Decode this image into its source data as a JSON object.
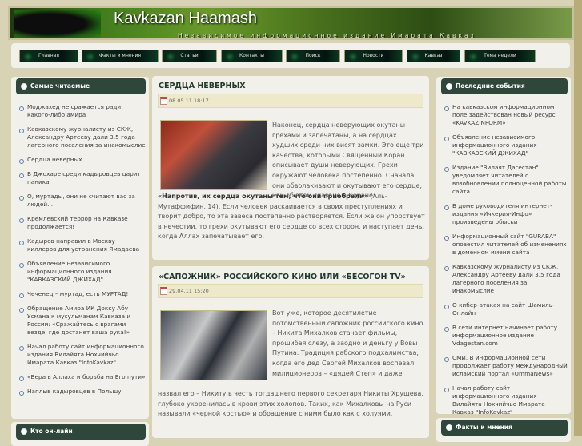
{
  "header": {
    "title": "Kavkazan Haamash",
    "subtitle": "Независимое информационное издание Имарата Кавказ"
  },
  "nav": [
    "Главная",
    "Факты и мнения",
    "Статьи",
    "Контакты",
    "Поиск",
    "Новости",
    "Кавказ",
    "Тема недели"
  ],
  "left": {
    "heading": "Самые читаемые",
    "items": [
      "Моджахед не сражается ради какого-либо амира",
      "Кавказскому журналисту из СКЖ, Александру Артееву дали 3.5 года лагерного поселения за инакомыслие",
      "Сердца неверных",
      "В Джохаре среди кадыровцев царит паника",
      "О, муртады, они не считают вас за людей...",
      "Кремлевский террор на Кавказе продолжается!",
      "Кадыров направил в Москву киллеров для устранения Ямадаева",
      "Объявление независимого информационного издания \"КАВКАЗСКИЙ ДЖИХАД\"",
      "Чеченец – муртад, есть МУРТАД!",
      "Обращение Амира ИК Доккy Абу Усмана к мусульманам Кавказа и России: «Сражайтесь с врагами везде, где достанет ваша рука!»",
      "Начал работу сайт информационного издания Вилайята Нохчийчьо Имарата Кавказ \"InfoKavkaz\"",
      "«Вера в Аллаха и борьба на Его пути»",
      "Наплыв кадыровцев в Польшу"
    ],
    "heading2": "Кто он-лайн"
  },
  "right": {
    "heading": "Последние события",
    "items": [
      "На кавказском информационном поле задействован новый ресурс «KAVKAZINFORM»",
      "Объявление независимого информационного издания \"КАВКАЗСКИЙ ДЖИХАД\"",
      "Издание \"Вилаят Дагестан\" уведомляет читателей о возобновлении полноценной работы сайта",
      "В доме руководителя интернет-издания «Ичкерия-Инфо» произведены обыски",
      "Информационный сайт \"GURABA\" оповестил читателей об изменениях в доменном имени сайта",
      "Кавказскому журналисту из СКЖ, Александру Артееву дали 3.5 года лагерного поселения за инакомыслие",
      "О кибер-атаках на сайт Шамиль-Онлайн",
      "В сети интернет начинает работу информационное издание Vdagestan.com",
      "СМИ. В информационной сети продолжает работу международный исламский портал «UmmaNews»",
      "Начал работу сайт информационного издания Вилайята Нохчийчьо Имарата Кавказ \"InfoKavkaz\""
    ],
    "heading2": "Факты и мнения"
  },
  "posts": [
    {
      "title": "СЕРДЦА НЕВЕРНЫХ",
      "date": "08.05.11 18:17",
      "text_side": "Наконец, сердца неверующих окутаны грехами и запечатаны, а на сердцах худших среди них висят замки. Это еще три качества, которыми Священный Коран описывает души неверующих. Грехи окружают человека постепенно. Сначала они обволакивают и окутывают его сердце, как об этом сказано в Коране:",
      "quote": "«Напротив, их сердца окутаны тем, что они приобрели»",
      "text_rest": " (Аль-Мутаффифин, 14). Если человек раскаивается в своих преступлениях и творит добро, то эта завеса постепенно растворяется. Если же он упорствует в нечестии, то грехи окутывают его сердце со всех сторон, и наступает день, когда Аллах запечатывает его."
    },
    {
      "title": "«САПОЖНИК» РОССИЙСКОГО КИНО ИЛИ «БЕСОГОН TV»",
      "date": "29.04.11 15:20",
      "text_side": "Вот уже, которое десятилетие потомственный сапожник российского кино – Никита Михалков стачает фильмы, прошибая слезу, а заодно и деньгу у Вовы Путина. Традиция рабского подхалимства, когда его дед Сергей Михалков воспевал милиционеров – «дядей Степ» и даже",
      "text_rest": "назвал его – Никиту в честь тогдашнего первого секретаря Никиты Хрущева, глубоко укоренилась в крови этих холопов. Таких, как Михалковы на Руси называли «черной костью» и обращение с ними было как с холуями."
    }
  ]
}
